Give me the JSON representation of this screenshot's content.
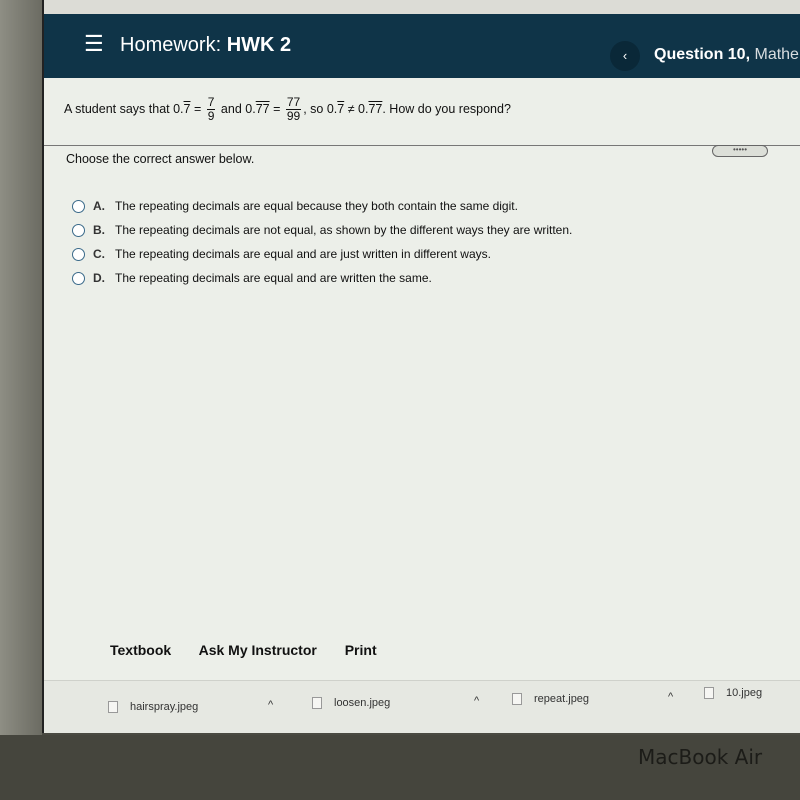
{
  "header": {
    "menu_icon": "☰",
    "title_prefix": "Homework:",
    "title_name": "HWK 2",
    "back_icon": "‹",
    "question_label": "Question 10,",
    "question_subject": "Mathem"
  },
  "question": {
    "part1": "A student says that 0.",
    "rep1": "7",
    "eq1": " =",
    "frac1_num": "7",
    "frac1_den": "9",
    "part2": " and 0.",
    "rep2": "77",
    "eq2": " =",
    "frac2_num": "77",
    "frac2_den": "99",
    "part3": ", so 0.",
    "rep3": "7",
    "neq": " ≠ 0.",
    "rep4": "77",
    "part4": ". How do you respond?"
  },
  "more_button": "•••••",
  "instruction": "Choose the correct answer below.",
  "options": [
    {
      "letter": "A.",
      "text": "The repeating decimals are equal because they both contain the same digit."
    },
    {
      "letter": "B.",
      "text": "The repeating decimals are not equal, as shown by the different ways they are written."
    },
    {
      "letter": "C.",
      "text": "The repeating decimals are equal and are just written in different ways."
    },
    {
      "letter": "D.",
      "text": "The repeating decimals are equal and are written the same."
    }
  ],
  "footer": {
    "textbook": "Textbook",
    "ask": "Ask My Instructor",
    "print": "Print"
  },
  "downloads": [
    {
      "name": "hairspray.jpeg"
    },
    {
      "name": "loosen.jpeg"
    },
    {
      "name": "repeat.jpeg"
    },
    {
      "name": "10.jpeg"
    }
  ],
  "chevron_up": "^",
  "device_label": "MacBook Air"
}
